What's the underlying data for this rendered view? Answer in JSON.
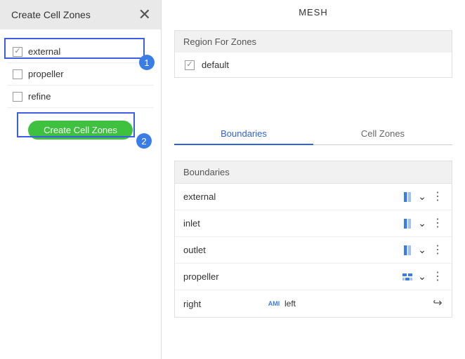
{
  "sidebar": {
    "title": "Create Cell Zones",
    "close_symbol": "✕",
    "items": [
      {
        "label": "external",
        "checked": true
      },
      {
        "label": "propeller",
        "checked": false
      },
      {
        "label": "refine",
        "checked": false
      }
    ],
    "create_button_label": "Create Cell Zones",
    "callouts": {
      "one": "1",
      "two": "2"
    }
  },
  "main": {
    "title": "MESH",
    "region": {
      "header": "Region For Zones",
      "items": [
        {
          "label": "default",
          "checked": true
        }
      ]
    },
    "tabs": [
      {
        "label": "Boundaries",
        "active": true
      },
      {
        "label": "Cell Zones",
        "active": false
      }
    ],
    "boundaries": {
      "header": "Boundaries",
      "rows": [
        {
          "name": "external",
          "icon": "sliver",
          "expandable": true,
          "kebab": true
        },
        {
          "name": "inlet",
          "icon": "sliver",
          "expandable": true,
          "kebab": true
        },
        {
          "name": "outlet",
          "icon": "sliver",
          "expandable": true,
          "kebab": true
        },
        {
          "name": "propeller",
          "icon": "brick",
          "expandable": true,
          "kebab": true
        },
        {
          "name": "right",
          "icon": "ami",
          "pair_label": "left",
          "link": true
        }
      ],
      "ami_text": "AMI"
    }
  }
}
